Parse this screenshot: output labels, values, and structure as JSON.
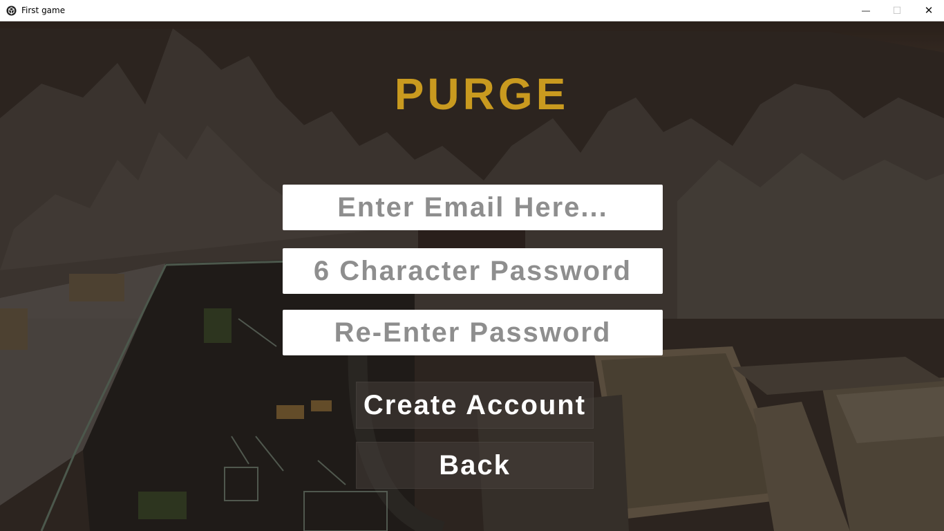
{
  "window": {
    "title": "First game",
    "minimize_glyph": "—",
    "maximize_glyph": "☐",
    "close_glyph": "✕",
    "app_icon": "unity-cube-icon"
  },
  "game": {
    "title": "PURGE"
  },
  "form": {
    "email_placeholder": "Enter Email Here...",
    "password_placeholder": "6 Character Password",
    "reenter_placeholder": "Re-Enter Password"
  },
  "buttons": {
    "create_account": "Create Account",
    "back": "Back"
  },
  "colors": {
    "title_gold": "#c99a1f",
    "placeholder_grey": "#8e8e8e",
    "button_bg": "#463e3a"
  }
}
